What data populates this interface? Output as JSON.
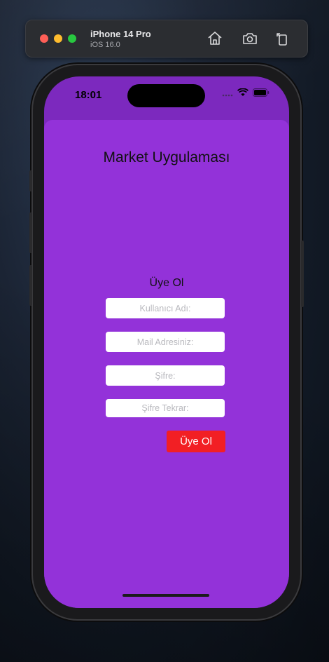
{
  "simulator": {
    "device_name": "iPhone 14 Pro",
    "os_version": "iOS 16.0",
    "icons": [
      "home-icon",
      "screenshot-icon",
      "rotate-icon"
    ]
  },
  "status_bar": {
    "time": "18:01",
    "icons": [
      "signal-icon",
      "wifi-icon",
      "battery-icon"
    ]
  },
  "app": {
    "title": "Market Uygulaması",
    "form_title": "Üye Ol",
    "fields": {
      "username_placeholder": "Kullanıcı Adı:",
      "email_placeholder": "Mail Adresiniz:",
      "password_placeholder": "Şifre:",
      "password_repeat_placeholder": "Şifre Tekrar:"
    },
    "register_button": "Üye Ol"
  },
  "colors": {
    "sheet_background": "#9332d9",
    "button_background": "#f21f24"
  }
}
